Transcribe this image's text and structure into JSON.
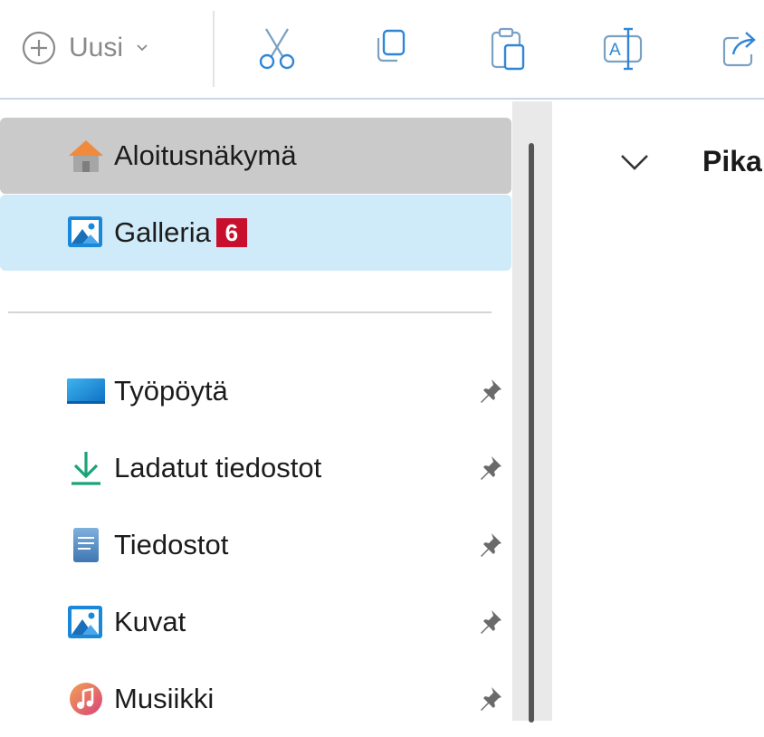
{
  "toolbar": {
    "new_label": "Uusi",
    "icons": [
      "plus-circle-icon",
      "chevron-down-icon",
      "cut-icon",
      "copy-icon",
      "paste-icon",
      "rename-icon",
      "share-icon"
    ]
  },
  "sidebar": {
    "home_label": "Aloitusnäkymä",
    "gallery_label": "Galleria",
    "gallery_badge": "6",
    "items": [
      {
        "label": "Työpöytä",
        "icon": "desktop-icon"
      },
      {
        "label": "Ladatut tiedostot",
        "icon": "download-icon"
      },
      {
        "label": "Tiedostot",
        "icon": "documents-icon"
      },
      {
        "label": "Kuvat",
        "icon": "pictures-icon"
      },
      {
        "label": "Musiikki",
        "icon": "music-icon"
      }
    ]
  },
  "main": {
    "section_title": "Pika"
  },
  "colors": {
    "home_bg": "#cacaca",
    "gallery_bg": "#cfeaf8",
    "badge": "#c8102e",
    "accent": "#1a88d8"
  }
}
